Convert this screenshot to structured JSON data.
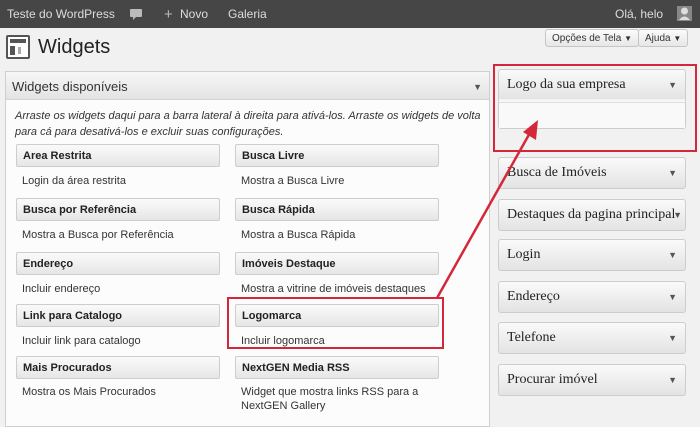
{
  "admin_bar": {
    "site_name": "Teste do WordPress",
    "new_label": "Novo",
    "gallery_label": "Galeria",
    "greeting": "Olá, helo"
  },
  "screen_options_label": "Opções de Tela",
  "help_label": "Ajuda",
  "page_title": "Widgets",
  "available": {
    "title": "Widgets disponíveis",
    "description": "Arraste os widgets daqui para a barra lateral à direita para ativá-los. Arraste os widgets de volta para cá para desativá-los e excluir suas configurações.",
    "widgets": [
      {
        "name": "Area Restrita",
        "desc": "Login da área restrita"
      },
      {
        "name": "Busca Livre",
        "desc": "Mostra a Busca Livre"
      },
      {
        "name": "Busca por Referência",
        "desc": "Mostra a Busca por Referência"
      },
      {
        "name": "Busca Rápida",
        "desc": "Mostra a Busca Rápida"
      },
      {
        "name": "Endereço",
        "desc": "Incluir endereço"
      },
      {
        "name": "Imóveis Destaque",
        "desc": "Mostra a vitrine de imóveis destaques"
      },
      {
        "name": "Link para Catalogo",
        "desc": "Incluir link para catalogo"
      },
      {
        "name": "Logomarca",
        "desc": "Incluir logomarca"
      },
      {
        "name": "Mais Procurados",
        "desc": "Mostra os Mais Procurados"
      },
      {
        "name": "NextGEN Media RSS",
        "desc": "Widget que mostra links RSS para a NextGEN Gallery"
      }
    ]
  },
  "sidebars": [
    {
      "title": "Logo da sua empresa"
    },
    {
      "title": "Busca de Imóveis"
    },
    {
      "title": "Destaques da pagina principal"
    },
    {
      "title": "Login"
    },
    {
      "title": "Endereço"
    },
    {
      "title": "Telefone"
    },
    {
      "title": "Procurar imóvel"
    }
  ],
  "annotation_color": "#d4283a"
}
